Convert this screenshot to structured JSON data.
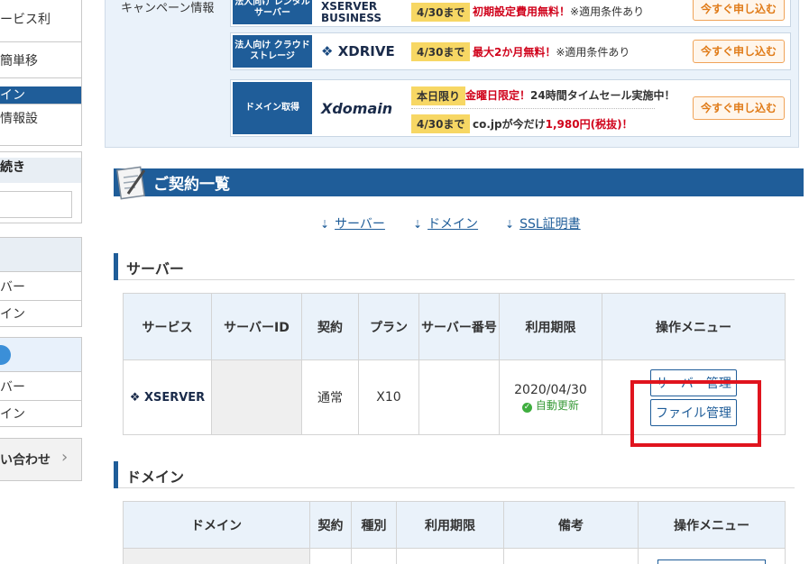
{
  "sidebar": {
    "items": [
      {
        "label": "ービス利"
      },
      {
        "label": "簡単移"
      },
      {
        "label": "イン"
      },
      {
        "label": "情報設"
      }
    ],
    "procedure": {
      "label": "続き"
    },
    "group1": [
      "バー",
      "イン"
    ],
    "group2": [
      "バー",
      "イン"
    ],
    "contact": {
      "label": "い合わせ",
      "chevron": "›"
    }
  },
  "campaign": {
    "label": "キャンペーン情報",
    "rows": [
      {
        "tag": "法人向け レンタルサーバー",
        "logo": "XSERVER BUSINESS",
        "badge": "4/30まで",
        "highlight": "初期設定費用無料！",
        "note": "※適用条件あり",
        "button": "今すぐ申し込む"
      },
      {
        "tag": "法人向け クラウド ストレージ",
        "logo": "XDRIVE",
        "badge": "4/30まで",
        "highlight": "最大2か月無料！",
        "note": "※適用条件あり",
        "button": "今すぐ申し込む"
      },
      {
        "tag": "ドメイン取得",
        "logo": "Xdomain",
        "badge1": "本日限り",
        "highlight1": "金曜日限定！",
        "text1": "24時間タイムセール実施中！",
        "badge2": "4/30まで",
        "text2a": "co.jpが今だけ",
        "highlight2": "1,980円(税抜)！",
        "button": "今すぐ申し込む"
      }
    ]
  },
  "contracts": {
    "title": "ご契約一覧",
    "anchors": [
      "サーバー",
      "ドメイン",
      "SSL証明書"
    ]
  },
  "server_section": {
    "heading": "サーバー",
    "columns": [
      "サービス",
      "サーバーID",
      "契約",
      "プラン",
      "サーバー番号",
      "利用期限",
      "操作メニュー"
    ],
    "row": {
      "service": "XSERVER",
      "server_id": "",
      "contract": "通常",
      "plan": "X10",
      "server_no": "",
      "expiry": "2020/04/30",
      "auto_renew": "自動更新",
      "btn_manage": "サーバー管理",
      "btn_files": "ファイル管理"
    }
  },
  "domain_section": {
    "heading": "ドメイン",
    "columns": [
      "ドメイン",
      "契約",
      "種別",
      "利用期限",
      "備考",
      "操作メニュー"
    ]
  },
  "colors": {
    "primary": "#1f5d99",
    "highlight_box": "#e0141e",
    "header_bg": "#eaf2fa"
  }
}
